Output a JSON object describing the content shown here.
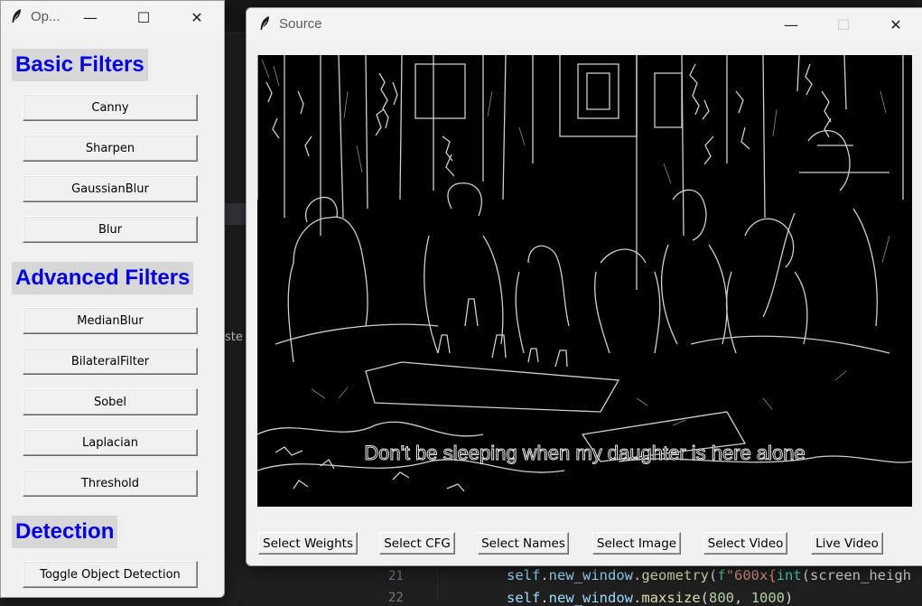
{
  "editor": {
    "side_fragment": "ste",
    "line_numbers": [
      "21",
      "22"
    ],
    "code_line_21": {
      "obj": "self",
      "dot1": ".",
      "attr": "new_window",
      "dot2": ".",
      "method": "geometry",
      "paren": "(",
      "prefix": "f",
      "string": "\"600x{",
      "builtin": "int",
      "rest": "(screen_heigh"
    },
    "code_line_22": {
      "obj": "self",
      "dot1": ".",
      "attr": "new_window",
      "dot2": ".",
      "method": "maxsize",
      "paren": "(",
      "num1": "800",
      "sep": ", ",
      "num2": "1000",
      "close": ")"
    }
  },
  "options_window": {
    "title": "Op...",
    "controls": {
      "minimize": "—",
      "maximize": "☐",
      "close": "✕"
    },
    "sections": [
      {
        "heading": "Basic Filters",
        "buttons": [
          "Canny",
          "Sharpen",
          "GaussianBlur",
          "Blur"
        ]
      },
      {
        "heading": "Advanced Filters",
        "buttons": [
          "MedianBlur",
          "BilateralFilter",
          "Sobel",
          "Laplacian",
          "Threshold"
        ]
      },
      {
        "heading": "Detection",
        "buttons": [
          "Toggle Object Detection"
        ]
      }
    ]
  },
  "source_window": {
    "title": "Source",
    "controls": {
      "minimize": "—",
      "maximize": "☐",
      "close": "✕"
    },
    "video_subtitle": "Don't be sleeping when my daughter is here alone",
    "buttons": [
      "Select Weights",
      "Select CFG",
      "Select Names",
      "Select Image",
      "Select Video",
      "Live Video"
    ]
  },
  "colors": {
    "heading_text": "#0000ee",
    "heading_bg": "#d7d7d7",
    "window_bg": "#f0f0f0",
    "video_bg": "#000000",
    "editor_bg": "#1f1f1f"
  }
}
